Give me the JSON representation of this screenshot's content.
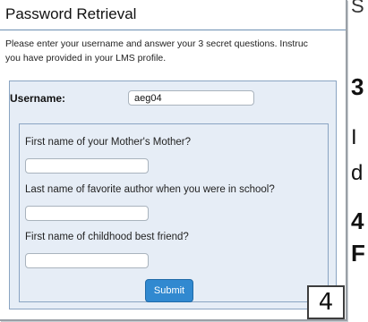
{
  "background_slide": {
    "fragments": [
      "S",
      "3",
      "I",
      "d",
      "4",
      "F"
    ]
  },
  "dialog": {
    "title": "Password Retrieval",
    "instructions_line1": "Please enter your username and answer your 3 secret questions. Instruc",
    "instructions_line2": "you have provided in your LMS profile.",
    "username_label": "Username:",
    "username_value": "aeg04",
    "questions": [
      {
        "label": "First name of your Mother's Mother?",
        "answer": ""
      },
      {
        "label": "Last name of favorite author when you were in school?",
        "answer": ""
      },
      {
        "label": "First name of childhood best friend?",
        "answer": ""
      }
    ],
    "submit_label": "Submit"
  },
  "page_badge": "4",
  "colors": {
    "accent": "#3189d0",
    "panel": "#e6edf6",
    "panel_border": "#8aa4c2"
  }
}
